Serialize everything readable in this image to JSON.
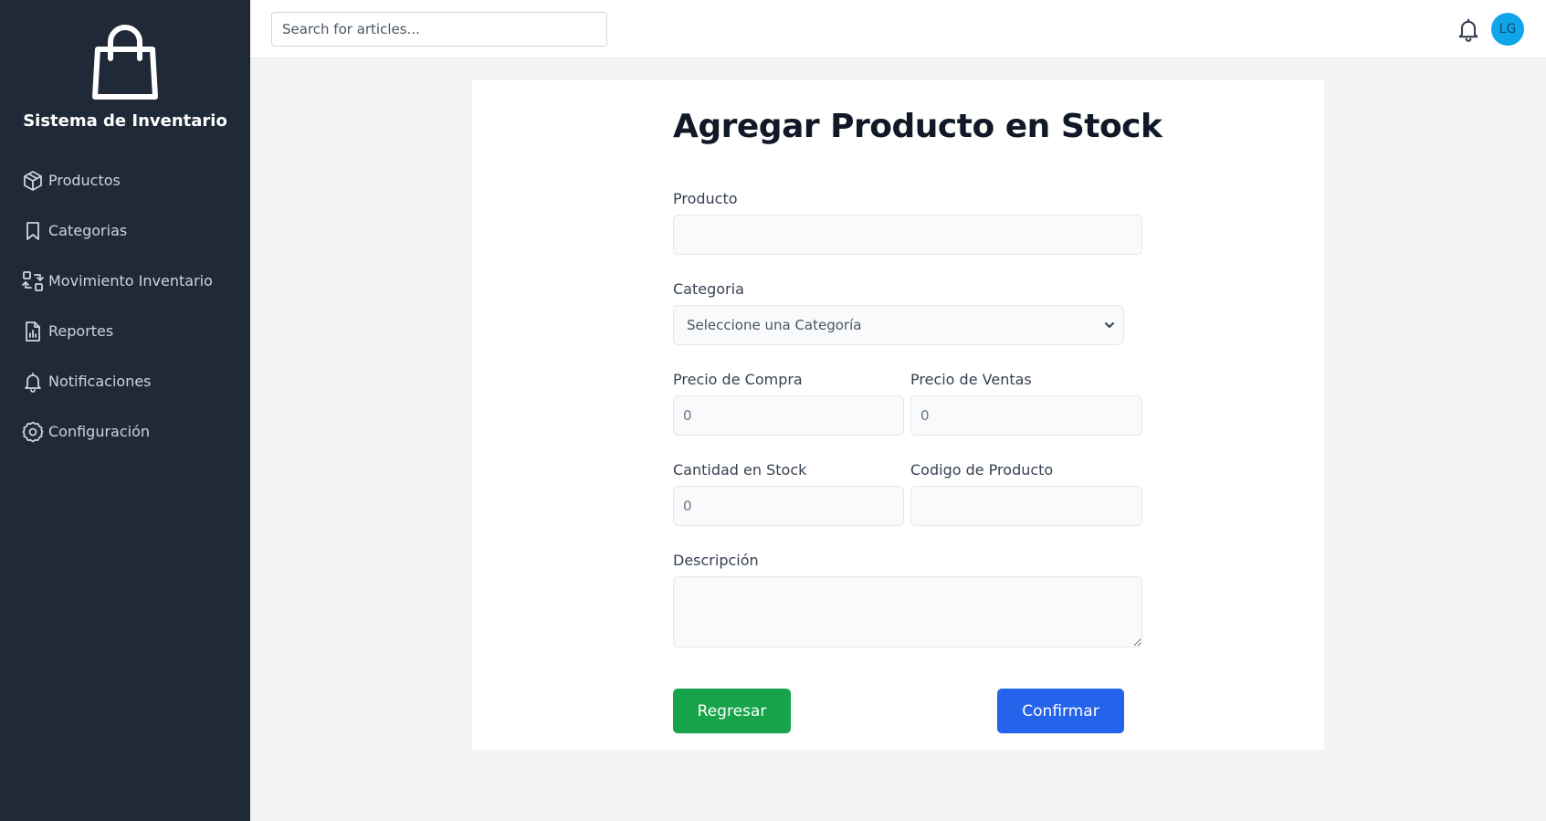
{
  "sidebar": {
    "brand": "Sistema de Inventario",
    "items": [
      {
        "label": "Productos",
        "icon": "cube-icon"
      },
      {
        "label": "Categorias",
        "icon": "bookmark-icon"
      },
      {
        "label": "Movimiento Inventario",
        "icon": "transfer-icon"
      },
      {
        "label": "Reportes",
        "icon": "report-icon"
      },
      {
        "label": "Notificaciones",
        "icon": "bell-icon"
      },
      {
        "label": "Configuración",
        "icon": "gear-icon"
      }
    ]
  },
  "header": {
    "search_placeholder": "Search for articles...",
    "avatar_initials": "LG"
  },
  "form": {
    "title": "Agregar Producto en Stock",
    "producto": {
      "label": "Producto",
      "value": ""
    },
    "categoria": {
      "label": "Categoria",
      "selected": "Seleccione una Categoría"
    },
    "precio_compra": {
      "label": "Precio de Compra",
      "placeholder": "0"
    },
    "precio_ventas": {
      "label": "Precio de Ventas",
      "placeholder": "0"
    },
    "cantidad_stock": {
      "label": "Cantidad en Stock",
      "placeholder": "0"
    },
    "codigo_producto": {
      "label": "Codigo de Producto",
      "value": ""
    },
    "descripcion": {
      "label": "Descripción",
      "value": ""
    },
    "back_label": "Regresar",
    "confirm_label": "Confirmar"
  },
  "colors": {
    "sidebar_bg": "#1f2937",
    "back_button": "#16a34a",
    "confirm_button": "#2563eb",
    "avatar_bg": "#0ea5e9"
  }
}
